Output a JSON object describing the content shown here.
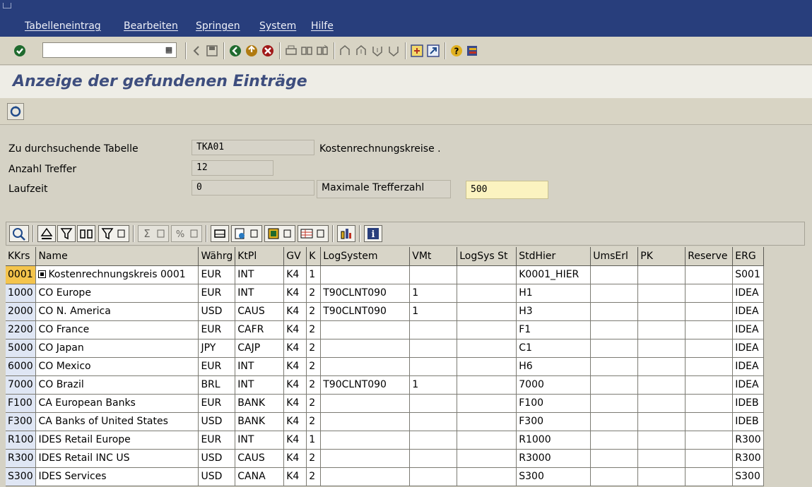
{
  "menu": {
    "items": [
      "Tabelleneintrag",
      "Bearbeiten",
      "Springen",
      "System",
      "Hilfe"
    ]
  },
  "toolbar": {
    "command_value": "",
    "icons": [
      "enter-icon",
      "save-icon",
      "back-icon",
      "exit-icon",
      "cancel-icon",
      "print-icon",
      "find-icon",
      "find-next-icon",
      "first-page-icon",
      "previous-page-icon",
      "next-page-icon",
      "last-page-icon",
      "create-session-icon",
      "shortcut-icon",
      "help-icon",
      "layout-icon"
    ]
  },
  "title": "Anzeige der gefundenen Einträge",
  "fields": {
    "table_label": "Zu durchsuchende Tabelle",
    "table_value": "TKA01",
    "table_desc": "Kostenrechnungskreise .",
    "hits_label": "Anzahl Treffer",
    "hits_value": "12",
    "runtime_label": "Laufzeit",
    "runtime_value": "0",
    "max_label": "Maximale Trefferzahl",
    "max_value": "500"
  },
  "grid": {
    "columns": [
      "KKrs",
      "Name",
      "Währg",
      "KtPl",
      "GV",
      "K",
      "LogSystem",
      "VMt",
      "LogSys St",
      "StdHier",
      "UmsErl",
      "PK",
      "Reserve",
      "ERG"
    ],
    "rows": [
      [
        "0001",
        "Kostenrechnungskreis 0001",
        "EUR",
        "INT",
        "K4",
        "1",
        "",
        "",
        "",
        "K0001_HIER",
        "",
        "",
        "",
        "S001"
      ],
      [
        "1000",
        "CO Europe",
        "EUR",
        "INT",
        "K4",
        "2",
        "T90CLNT090",
        "1",
        "",
        "H1",
        "",
        "",
        "",
        "IDEA"
      ],
      [
        "2000",
        "CO N. America",
        "USD",
        "CAUS",
        "K4",
        "2",
        "T90CLNT090",
        "1",
        "",
        "H3",
        "",
        "",
        "",
        "IDEA"
      ],
      [
        "2200",
        "CO France",
        "EUR",
        "CAFR",
        "K4",
        "2",
        "",
        "",
        "",
        "F1",
        "",
        "",
        "",
        "IDEA"
      ],
      [
        "5000",
        "CO Japan",
        "JPY",
        "CAJP",
        "K4",
        "2",
        "",
        "",
        "",
        "C1",
        "",
        "",
        "",
        "IDEA"
      ],
      [
        "6000",
        "CO Mexico",
        "EUR",
        "INT",
        "K4",
        "2",
        "",
        "",
        "",
        "H6",
        "",
        "",
        "",
        "IDEA"
      ],
      [
        "7000",
        "CO Brazil",
        "BRL",
        "INT",
        "K4",
        "2",
        "T90CLNT090",
        "1",
        "",
        "7000",
        "",
        "",
        "",
        "IDEA"
      ],
      [
        "F100",
        "CA European Banks",
        "EUR",
        "BANK",
        "K4",
        "2",
        "",
        "",
        "",
        "F100",
        "",
        "",
        "",
        "IDEB"
      ],
      [
        "F300",
        "CA Banks of United States",
        "USD",
        "BANK",
        "K4",
        "2",
        "",
        "",
        "",
        "F300",
        "",
        "",
        "",
        "IDEB"
      ],
      [
        "R100",
        "IDES Retail Europe",
        "EUR",
        "INT",
        "K4",
        "1",
        "",
        "",
        "",
        "R1000",
        "",
        "",
        "",
        "R300"
      ],
      [
        "R300",
        "IDES Retail INC US",
        "USD",
        "CAUS",
        "K4",
        "2",
        "",
        "",
        "",
        "R3000",
        "",
        "",
        "",
        "R300"
      ],
      [
        "S300",
        "IDES Services",
        "USD",
        "CANA",
        "K4",
        "2",
        "",
        "",
        "",
        "S300",
        "",
        "",
        "",
        "S300"
      ]
    ]
  },
  "colors": {
    "menubar": "#283e7c",
    "title": "#3e4e7e",
    "key_cell": "#dfe6f4",
    "selected_cell": "#f4c44c",
    "input_highlight": "#fbf3c0"
  }
}
